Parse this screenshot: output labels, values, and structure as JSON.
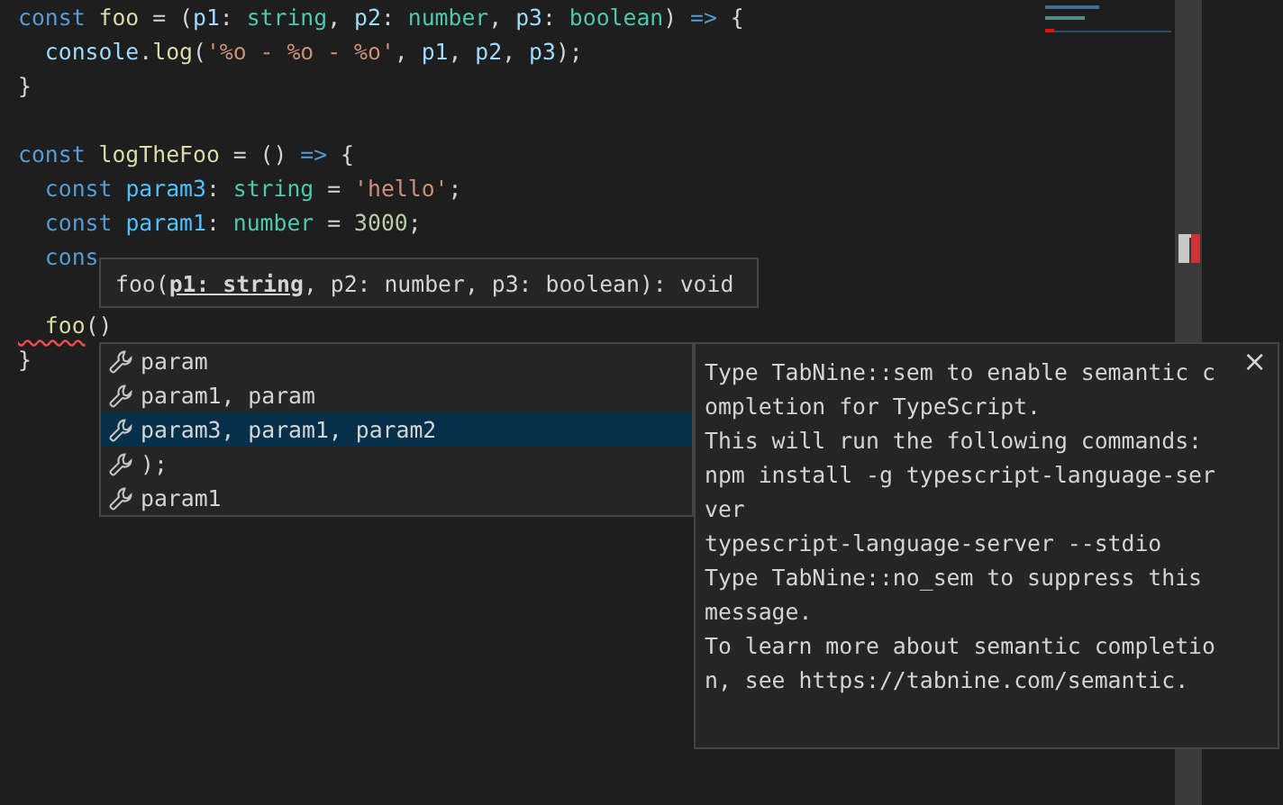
{
  "code_lines": [
    {
      "kind": "code",
      "tokens": [
        {
          "t": "const ",
          "kind": "kw"
        },
        {
          "t": "foo",
          "kind": "fn"
        },
        {
          "t": " = (",
          "kind": "plain"
        },
        {
          "t": "p1",
          "kind": "param"
        },
        {
          "t": ": ",
          "kind": "plain"
        },
        {
          "t": "string",
          "kind": "type"
        },
        {
          "t": ", ",
          "kind": "plain"
        },
        {
          "t": "p2",
          "kind": "param"
        },
        {
          "t": ": ",
          "kind": "plain"
        },
        {
          "t": "number",
          "kind": "type"
        },
        {
          "t": ", ",
          "kind": "plain"
        },
        {
          "t": "p3",
          "kind": "param"
        },
        {
          "t": ": ",
          "kind": "plain"
        },
        {
          "t": "boolean",
          "kind": "type"
        },
        {
          "t": ") ",
          "kind": "plain"
        },
        {
          "t": "=>",
          "kind": "kw"
        },
        {
          "t": " {",
          "kind": "plain"
        }
      ]
    },
    {
      "kind": "code",
      "tokens": [
        {
          "t": "  console",
          "kind": "param"
        },
        {
          "t": ".",
          "kind": "plain"
        },
        {
          "t": "log",
          "kind": "fn"
        },
        {
          "t": "(",
          "kind": "plain"
        },
        {
          "t": "'%o - %o - %o'",
          "kind": "str"
        },
        {
          "t": ", ",
          "kind": "plain"
        },
        {
          "t": "p1",
          "kind": "param"
        },
        {
          "t": ", ",
          "kind": "plain"
        },
        {
          "t": "p2",
          "kind": "param"
        },
        {
          "t": ", ",
          "kind": "plain"
        },
        {
          "t": "p3",
          "kind": "param"
        },
        {
          "t": ");",
          "kind": "plain"
        }
      ]
    },
    {
      "kind": "code",
      "tokens": [
        {
          "t": "}",
          "kind": "plain"
        }
      ]
    },
    {
      "kind": "blank"
    },
    {
      "kind": "code",
      "tokens": [
        {
          "t": "const ",
          "kind": "kw"
        },
        {
          "t": "logTheFoo",
          "kind": "fn"
        },
        {
          "t": " = () ",
          "kind": "plain"
        },
        {
          "t": "=>",
          "kind": "kw"
        },
        {
          "t": " {",
          "kind": "plain"
        }
      ]
    },
    {
      "kind": "code",
      "tokens": [
        {
          "t": "  const ",
          "kind": "kw"
        },
        {
          "t": "param3",
          "kind": "const"
        },
        {
          "t": ": ",
          "kind": "plain"
        },
        {
          "t": "string",
          "kind": "type"
        },
        {
          "t": " = ",
          "kind": "plain"
        },
        {
          "t": "'hello'",
          "kind": "str"
        },
        {
          "t": ";",
          "kind": "plain"
        }
      ]
    },
    {
      "kind": "code",
      "tokens": [
        {
          "t": "  const ",
          "kind": "kw"
        },
        {
          "t": "param1",
          "kind": "const"
        },
        {
          "t": ": ",
          "kind": "plain"
        },
        {
          "t": "number",
          "kind": "type"
        },
        {
          "t": " = ",
          "kind": "plain"
        },
        {
          "t": "3000",
          "kind": "num"
        },
        {
          "t": ";",
          "kind": "plain"
        }
      ]
    },
    {
      "kind": "code",
      "tokens": [
        {
          "t": "  cons",
          "kind": "kw"
        }
      ]
    },
    {
      "kind": "blank"
    },
    {
      "kind": "code",
      "tokens": [
        {
          "t": "  foo",
          "kind": "fn",
          "error": true
        },
        {
          "t": "()",
          "kind": "plain"
        }
      ]
    },
    {
      "kind": "code",
      "tokens": [
        {
          "t": "}",
          "kind": "plain"
        }
      ]
    }
  ],
  "signature_help": {
    "before": "foo(",
    "active": "p1: string",
    "after": ", p2: number, p3: boolean): void"
  },
  "suggestions": [
    {
      "label": "param",
      "selected": false
    },
    {
      "label": "param1, param",
      "selected": false
    },
    {
      "label": "param3, param1, param2",
      "selected": true
    },
    {
      "label": ");",
      "selected": false
    },
    {
      "label": "param1",
      "selected": false
    }
  ],
  "details": {
    "close": "×",
    "lines": [
      "Type TabNine::sem to enable semantic c",
      "ompletion for TypeScript.",
      "This will run the following commands:",
      "npm install -g typescript-language-ser",
      "ver",
      "typescript-language-server --stdio",
      "Type TabNine::no_sem to suppress this",
      "message.",
      "To learn more about semantic completio",
      "n, see https://tabnine.com/semantic."
    ]
  }
}
